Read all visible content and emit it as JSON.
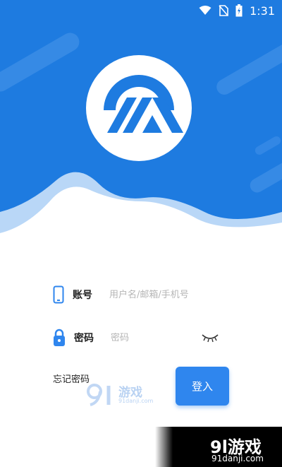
{
  "status_bar": {
    "time": "1:31",
    "icons": [
      "wifi-icon",
      "no-sim-icon",
      "battery-charging-icon"
    ]
  },
  "header": {
    "logo_icon": "app-logo-icon",
    "colors": {
      "primary": "#1e7be0",
      "wave_light": "#b9d7f7"
    }
  },
  "form": {
    "account": {
      "icon": "phone-icon",
      "label": "账号",
      "placeholder": "用户名/邮箱/手机号"
    },
    "password": {
      "icon": "lock-icon",
      "label": "密码",
      "placeholder": "密码",
      "toggle_icon": "eye-closed-icon"
    },
    "forgot_password": "忘记密码",
    "login_button": "登入"
  },
  "watermark": {
    "small_text": "游戏",
    "small_url": "91danji.com",
    "big_text": "9l游戏",
    "big_url": "91danji.com"
  }
}
